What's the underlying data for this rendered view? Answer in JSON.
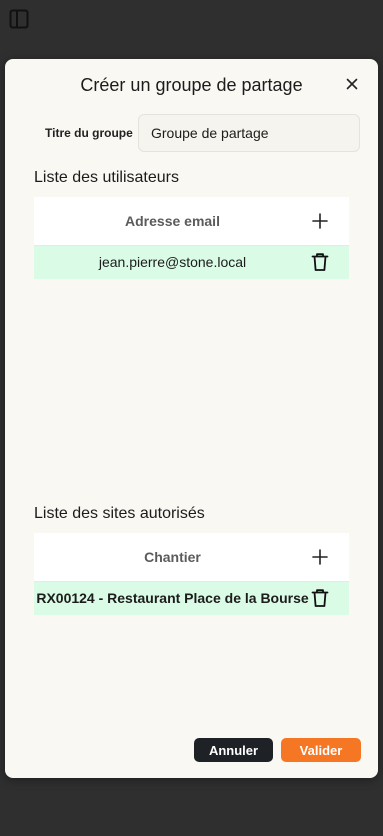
{
  "modal": {
    "title": "Créer un groupe de partage",
    "group_title_label": "Titre du groupe",
    "group_title_value": "Groupe de partage"
  },
  "users": {
    "section_title": "Liste des utilisateurs",
    "column_header": "Adresse email",
    "rows": [
      {
        "email": "jean.pierre@stone.local"
      }
    ]
  },
  "sites": {
    "section_title": "Liste des sites autorisés",
    "column_header": "Chantier",
    "rows": [
      {
        "name": "RX00124 - Restaurant Place de la Bourse"
      }
    ]
  },
  "actions": {
    "cancel_label": "Annuler",
    "validate_label": "Valider"
  },
  "icons": {
    "sidebar_toggle": "sidebar-toggle-icon",
    "close": "close-icon",
    "add": "plus-icon",
    "delete": "trash-icon"
  },
  "colors": {
    "row_highlight": "#dafbe5",
    "validate_button": "#f57623",
    "cancel_button": "#1e2125"
  }
}
